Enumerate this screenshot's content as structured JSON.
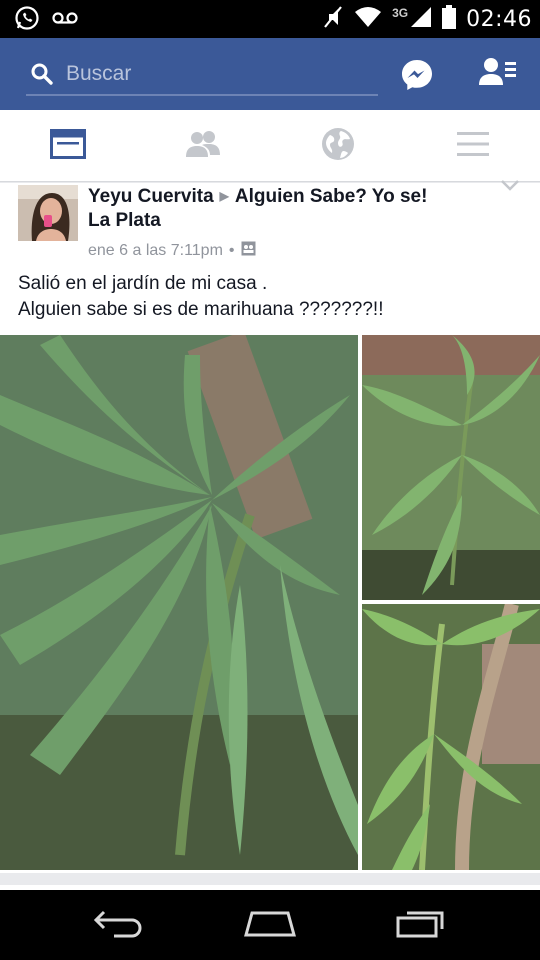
{
  "status_bar": {
    "time": "02:46",
    "network": "3G",
    "icons": [
      "whatsapp-icon",
      "voicemail-icon",
      "mute-icon",
      "wifi-icon",
      "signal-icon",
      "battery-icon"
    ]
  },
  "header": {
    "search_placeholder": "Buscar",
    "icons": [
      "search-icon",
      "messenger-icon",
      "friend-requests-icon"
    ]
  },
  "tabs": [
    {
      "icon": "news-feed-icon",
      "active": true
    },
    {
      "icon": "friends-icon",
      "active": false
    },
    {
      "icon": "globe-icon",
      "active": false
    },
    {
      "icon": "menu-icon",
      "active": false
    }
  ],
  "post": {
    "author": "Yeyu Cuervita",
    "group": "Alguien Sabe? Yo se!",
    "location": "La Plata",
    "timestamp": "ene 6 a las 7:11pm",
    "separator": "•",
    "text_line1": "Salió en el jardín de mi casa .",
    "text_line2": "Alguien sabe si es de marihuana ???????!!"
  },
  "colors": {
    "facebook_blue": "#3b5998",
    "active_tab": "#3b5998",
    "inactive_tab": "#c4c7cc",
    "meta_gray": "#90949c"
  }
}
